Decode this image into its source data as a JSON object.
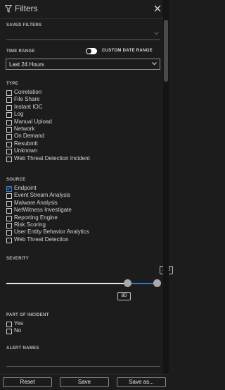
{
  "header": {
    "title": "Filters"
  },
  "saved_filters": {
    "label": "SAVED FILTERS",
    "value": ""
  },
  "time_range": {
    "label": "TIME RANGE",
    "custom_date_range_label": "CUSTOM DATE RANGE",
    "custom_date_range_on": true,
    "selected": "Last 24 Hours"
  },
  "type": {
    "label": "TYPE",
    "items": [
      {
        "label": "Correlation",
        "checked": false
      },
      {
        "label": "File Share",
        "checked": false
      },
      {
        "label": "Instant IOC",
        "checked": false
      },
      {
        "label": "Log",
        "checked": false
      },
      {
        "label": "Manual Upload",
        "checked": false
      },
      {
        "label": "Network",
        "checked": false
      },
      {
        "label": "On Demand",
        "checked": false
      },
      {
        "label": "Resubmit",
        "checked": false
      },
      {
        "label": "Unknown",
        "checked": false
      },
      {
        "label": "Web Threat Detection Incident",
        "checked": false
      }
    ]
  },
  "source": {
    "label": "SOURCE",
    "items": [
      {
        "label": "Endpoint",
        "checked": true
      },
      {
        "label": "Event Stream Analysis",
        "checked": false
      },
      {
        "label": "Malware Analysis",
        "checked": false
      },
      {
        "label": "NetWitness Investigate",
        "checked": false
      },
      {
        "label": "Reporting Engine",
        "checked": false
      },
      {
        "label": "Risk Scoring",
        "checked": false
      },
      {
        "label": "User Entity Behavior Analytics",
        "checked": false
      },
      {
        "label": "Web Threat Detection",
        "checked": false
      }
    ]
  },
  "severity": {
    "label": "SEVERITY",
    "min": "80",
    "max": "100"
  },
  "part_of_incident": {
    "label": "PART OF INCIDENT",
    "items": [
      {
        "label": "Yes",
        "checked": false
      },
      {
        "label": "No",
        "checked": false
      }
    ]
  },
  "alert_names": {
    "label": "ALERT NAMES",
    "value": ""
  },
  "footer": {
    "reset": "Reset",
    "save": "Save",
    "save_as": "Save as..."
  },
  "colors": {
    "accent": "#2b78d4",
    "background": "#1c1c1c"
  }
}
